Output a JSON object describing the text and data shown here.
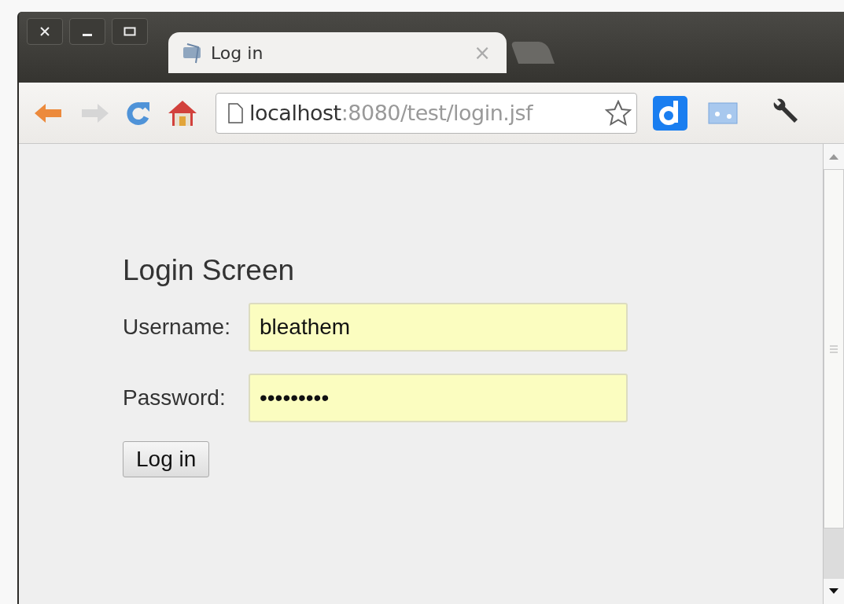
{
  "tab": {
    "title": "Log in",
    "close": "×"
  },
  "address": {
    "host": "localhost",
    "path": ":8080/test/login.jsf"
  },
  "form": {
    "heading": "Login Screen",
    "fields": [
      {
        "label": "Username:",
        "value": "bleathem"
      },
      {
        "label": "Password:",
        "value": "•••••••••"
      }
    ],
    "button": "Log in"
  }
}
